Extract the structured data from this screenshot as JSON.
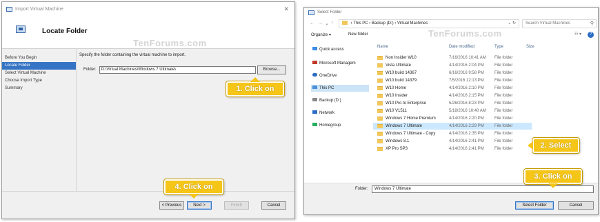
{
  "import_dialog": {
    "title": "Import Virtual Machine",
    "header_title": "Locate Folder",
    "watermark": "TenForums.com",
    "nav_items": [
      "Before You Begin",
      "Locate Folder",
      "Select Virtual Machine",
      "Choose Import Type",
      "Summary"
    ],
    "active_nav": "Locate Folder",
    "instruction": "Specify the folder containing the virtual machine to import.",
    "folder_label": "Folder:",
    "folder_value": "D:\\Virtual Machines\\Windows 7 Ultimate\\",
    "browse_label": "Browse...",
    "buttons": {
      "previous": "< Previous",
      "next": "Next >",
      "finish": "Finish",
      "cancel": "Cancel"
    }
  },
  "select_folder_dialog": {
    "title": "Select Folder",
    "breadcrumb": [
      "This PC",
      "Backup (D:)",
      "Virtual Machines"
    ],
    "search_placeholder": "Search Virtual Machines",
    "organize_label": "Organize ▾",
    "new_folder_label": "New folder",
    "watermark": "TenForums.com",
    "tree": [
      {
        "label": "Quick access",
        "icon": "star-icon"
      },
      {
        "label": "Microsoft Managem",
        "icon": "office-icon"
      },
      {
        "label": "OneDrive",
        "icon": "cloud-icon"
      },
      {
        "label": "This PC",
        "icon": "computer-icon"
      },
      {
        "label": "Backup (D:)",
        "icon": "drive-icon"
      },
      {
        "label": "Network",
        "icon": "network-icon"
      },
      {
        "label": "Homegroup",
        "icon": "homegroup-icon"
      }
    ],
    "selected_tree": "This PC",
    "columns": [
      "Name",
      "Date modified",
      "Type",
      "Size"
    ],
    "rows": [
      {
        "name": "Non Insider W10",
        "date": "7/16/2016 10:41 AM",
        "type": "File folder"
      },
      {
        "name": "Vista Ultimate",
        "date": "4/14/2016 2:04 PM",
        "type": "File folder"
      },
      {
        "name": "W10 build 14367",
        "date": "6/16/2016 9:58 PM",
        "type": "File folder"
      },
      {
        "name": "W10 build 14379",
        "date": "7/5/2016 12:13 PM",
        "type": "File folder"
      },
      {
        "name": "W10 Home",
        "date": "4/14/2016 2:10 PM",
        "type": "File folder"
      },
      {
        "name": "W10 Insider",
        "date": "4/14/2016 2:15 PM",
        "type": "File folder"
      },
      {
        "name": "W10 Pro to Enterprise",
        "date": "5/26/2016 8:23 PM",
        "type": "File folder"
      },
      {
        "name": "W10 V1511",
        "date": "5/18/2016 10:40 AM",
        "type": "File folder"
      },
      {
        "name": "Windows 7 Home Premium",
        "date": "4/14/2016 2:20 PM",
        "type": "File folder"
      },
      {
        "name": "Windows 7 Ultimate",
        "date": "4/14/2016 2:29 PM",
        "type": "File folder"
      },
      {
        "name": "Windows 7 Ultimate - Copy",
        "date": "4/14/2016 2:35 PM",
        "type": "File folder"
      },
      {
        "name": "Windows 8.1",
        "date": "4/14/2016 2:41 PM",
        "type": "File folder"
      },
      {
        "name": "XP Pro SP3",
        "date": "4/14/2016 2:41 PM",
        "type": "File folder"
      }
    ],
    "selected_row": "Windows 7 Ultimate",
    "folder_label": "Folder:",
    "folder_value": "Windows 7 Ultimate",
    "buttons": {
      "select": "Select Folder",
      "cancel": "Cancel"
    }
  },
  "callouts": {
    "step1": "1. Click on",
    "step2": "2. Select",
    "step3": "3. Click on",
    "step4": "4. Click on"
  },
  "colors": {
    "callout": "#f5c518",
    "accent": "#3574c4",
    "selection": "#cce8ff"
  }
}
